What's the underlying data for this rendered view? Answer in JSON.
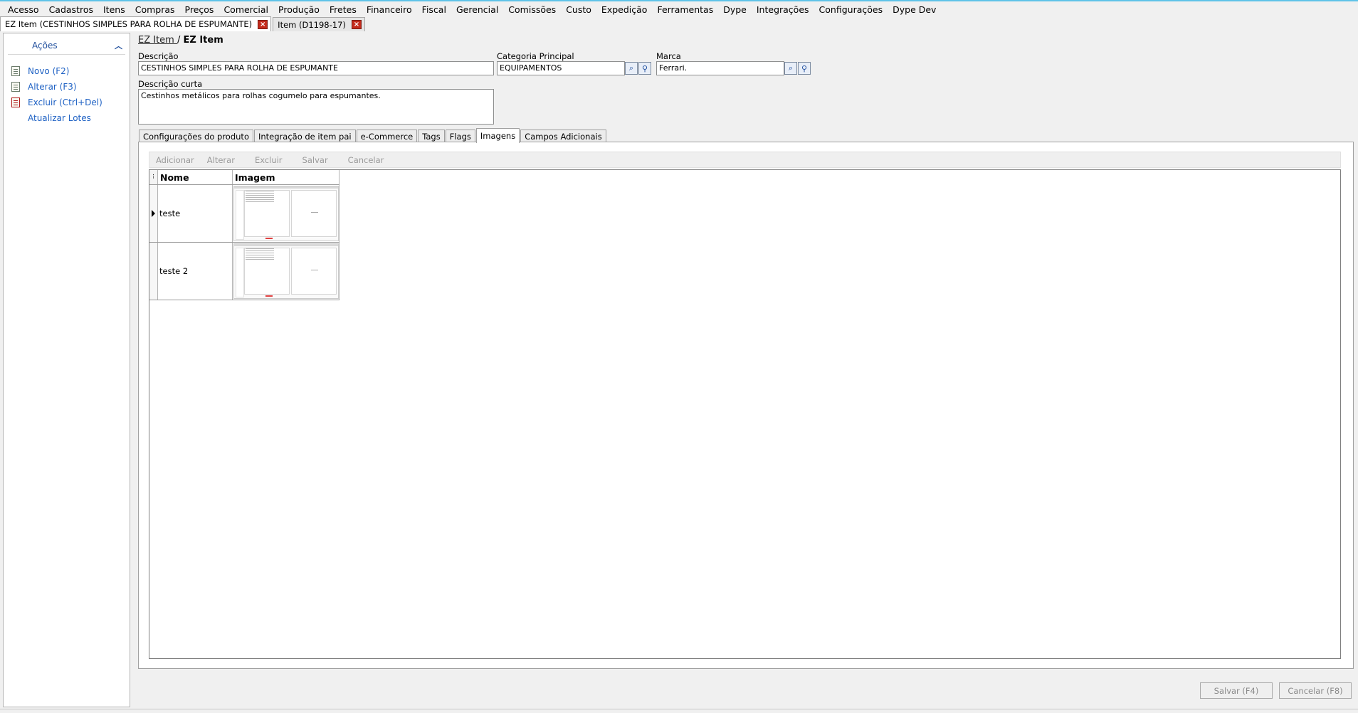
{
  "menu": [
    "Acesso",
    "Cadastros",
    "Itens",
    "Compras",
    "Preços",
    "Comercial",
    "Produção",
    "Fretes",
    "Financeiro",
    "Fiscal",
    "Gerencial",
    "Comissões",
    "Custo",
    "Expedição",
    "Ferramentas",
    "Dype",
    "Integrações",
    "Configurações",
    "Dype Dev"
  ],
  "doc_tabs": [
    {
      "label": "EZ Item (CESTINHOS SIMPLES PARA ROLHA DE ESPUMANTE)"
    },
    {
      "label": "Item (D1198-17)"
    }
  ],
  "actions": {
    "title": "Ações",
    "items": [
      {
        "label": "Novo (F2)",
        "icon": "document-icon"
      },
      {
        "label": "Alterar (F3)",
        "icon": "edit-document-icon"
      },
      {
        "label": "Excluir (Ctrl+Del)",
        "icon": "delete-document-icon"
      },
      {
        "label": "Atualizar Lotes",
        "icon": ""
      }
    ]
  },
  "breadcrumb": {
    "link": "EZ Item ",
    "separator": " / ",
    "current": "EZ Item"
  },
  "form": {
    "descricao_label": "Descrição",
    "descricao_value": "CESTINHOS SIMPLES PARA ROLHA DE ESPUMANTE",
    "categoria_label": "Categoria Principal",
    "categoria_value": "EQUIPAMENTOS",
    "marca_label": "Marca",
    "marca_value": "Ferrari.",
    "descricao_curta_label": "Descrição curta",
    "descricao_curta_value": "Cestinhos metálicos para rolhas cogumelo para espumantes."
  },
  "inner_tabs": [
    "Configurações do produto",
    "Integração de item pai",
    "e-Commerce",
    "Tags",
    "Flags",
    "Imagens",
    "Campos Adicionais"
  ],
  "active_inner_tab": "Imagens",
  "grid_toolbar": [
    "Adicionar",
    "Alterar",
    "Excluir",
    "Salvar",
    "Cancelar"
  ],
  "grid": {
    "columns": [
      "Nome",
      "Imagem"
    ],
    "rows": [
      {
        "nome": "teste"
      },
      {
        "nome": "teste 2"
      }
    ]
  },
  "footer": {
    "save_label": "Salvar (F4)",
    "cancel_label": "Cancelar (F8)"
  },
  "colors": {
    "link_blue": "#1f62c4",
    "close_red": "#c42b1c",
    "accent_top": "#5fc3e8"
  }
}
